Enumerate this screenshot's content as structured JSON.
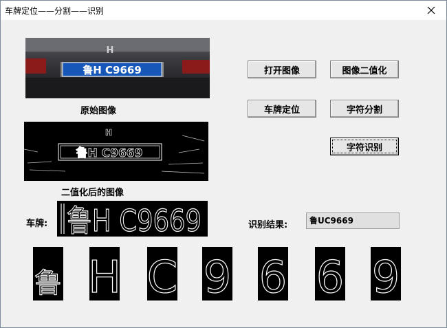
{
  "window": {
    "title": "车牌定位——分割——识别"
  },
  "images": {
    "original": {
      "caption": "原始图像",
      "plate_text": "鲁H C9669"
    },
    "binary": {
      "caption": "二值化后的图像",
      "plate_text": "鲁H C9669"
    }
  },
  "buttons": {
    "open_image": "打开图像",
    "binarize": "图像二值化",
    "locate_plate": "车牌定位",
    "segment_chars": "字符分割",
    "recognize_chars": "字符识别"
  },
  "plate": {
    "label": "车牌:",
    "text": "鲁H C9669"
  },
  "recognition": {
    "label": "识别结果:",
    "value": "鲁UC9669"
  },
  "segmented_chars": [
    "鲁",
    "H",
    "C",
    "9",
    "6",
    "6",
    "9"
  ],
  "colors": {
    "plate_blue": "#1657b8",
    "window_bg": "#f0f0f0"
  }
}
